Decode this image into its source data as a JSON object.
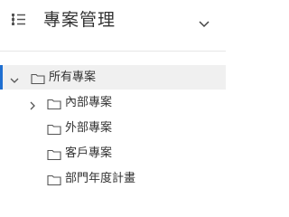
{
  "header": {
    "title": "專案管理",
    "icon": "tree-structure-icon",
    "chevron": "chevron-down-icon"
  },
  "tree": {
    "root": {
      "label": "所有專案",
      "expanded": true,
      "selected": true
    },
    "children": [
      {
        "label": "內部專案",
        "has_children": true
      },
      {
        "label": "外部專案",
        "has_children": false
      },
      {
        "label": "客戶專案",
        "has_children": false
      },
      {
        "label": "部門年度計畫",
        "has_children": false
      }
    ]
  },
  "colors": {
    "text": "#333333",
    "icon": "#555555",
    "selected_background": "#f0f0f0",
    "selected_accent": "#1f6fd1",
    "divider": "#e6e6e6"
  }
}
